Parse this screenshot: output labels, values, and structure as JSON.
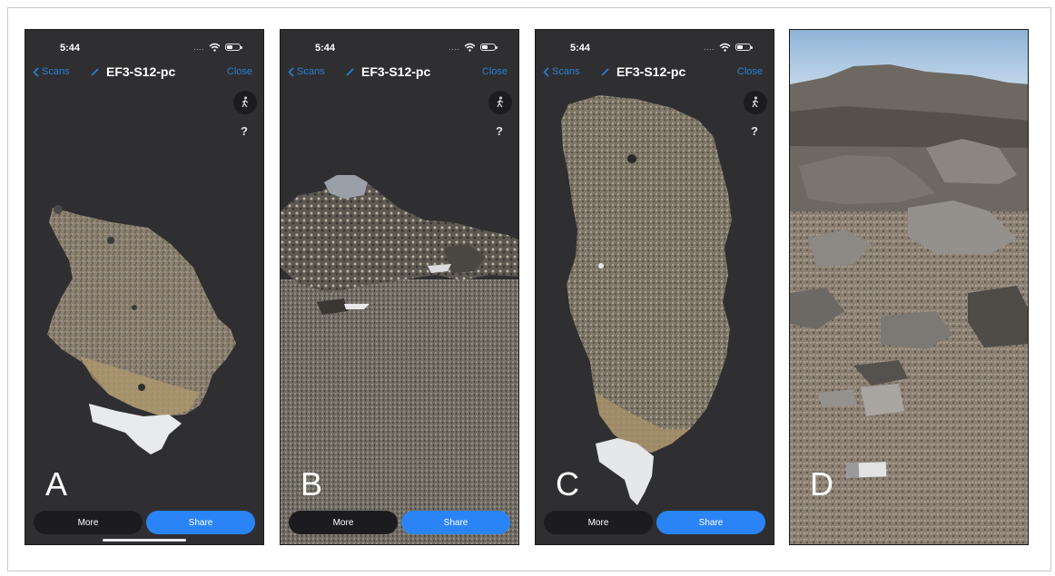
{
  "panels": [
    {
      "status_time": "5:44",
      "status_dots": "....",
      "back_label": "Scans",
      "title": "EF3-S12-pc",
      "close_label": "Close",
      "help_text": "?",
      "more_label": "More",
      "share_label": "Share",
      "letter": "A"
    },
    {
      "status_time": "5:44",
      "status_dots": "....",
      "back_label": "Scans",
      "title": "EF3-S12-pc",
      "close_label": "Close",
      "help_text": "?",
      "more_label": "More",
      "share_label": "Share",
      "letter": "B"
    },
    {
      "status_time": "5:44",
      "status_dots": "....",
      "back_label": "Scans",
      "title": "EF3-S12-pc",
      "close_label": "Close",
      "help_text": "?",
      "more_label": "More",
      "share_label": "Share",
      "letter": "C"
    }
  ],
  "photo": {
    "letter": "D"
  },
  "icons": {
    "back": "chevron-left-icon",
    "edit": "pencil-icon",
    "walk": "walking-person-icon",
    "wifi": "wifi-icon",
    "battery": "battery-icon",
    "help": "question-mark-icon"
  },
  "colors": {
    "accent": "#2a84f5",
    "link": "#2a7fd6",
    "app_background": "#2f2f31",
    "more_button": "#1c1c1e"
  }
}
